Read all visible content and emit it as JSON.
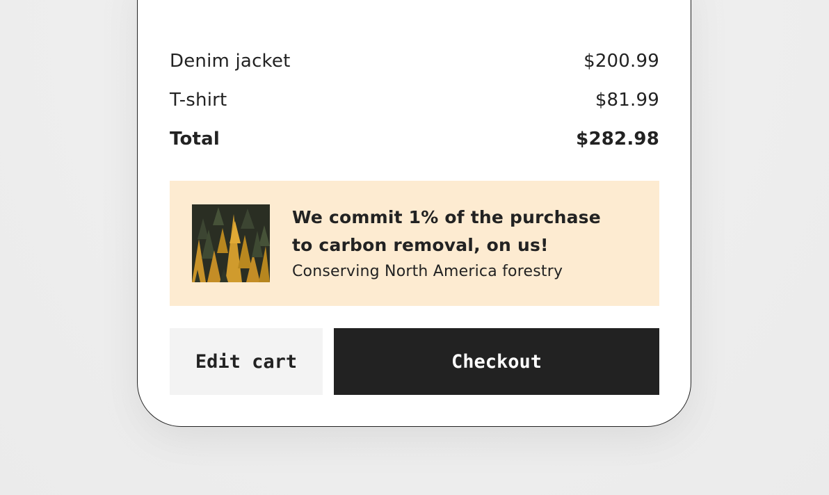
{
  "order": {
    "items": [
      {
        "name": "Denim jacket",
        "price": "$200.99"
      },
      {
        "name": "T-shirt",
        "price": "$81.99"
      }
    ],
    "total": {
      "label": "Total",
      "price": "$282.98"
    }
  },
  "promo": {
    "heading_line1": "We commit 1% of the purchase",
    "heading_line2": "to carbon removal, on us!",
    "subtitle": "Conserving North America forestry",
    "image_icon": "forest-thumbnail-image"
  },
  "actions": {
    "edit_label": "Edit cart",
    "checkout_label": "Checkout"
  },
  "colors": {
    "background": "#efefef",
    "card": "#ffffff",
    "promo_background": "#fdebd1",
    "checkout_button": "#222222",
    "edit_button": "#f3f3f3",
    "text": "#222222"
  }
}
